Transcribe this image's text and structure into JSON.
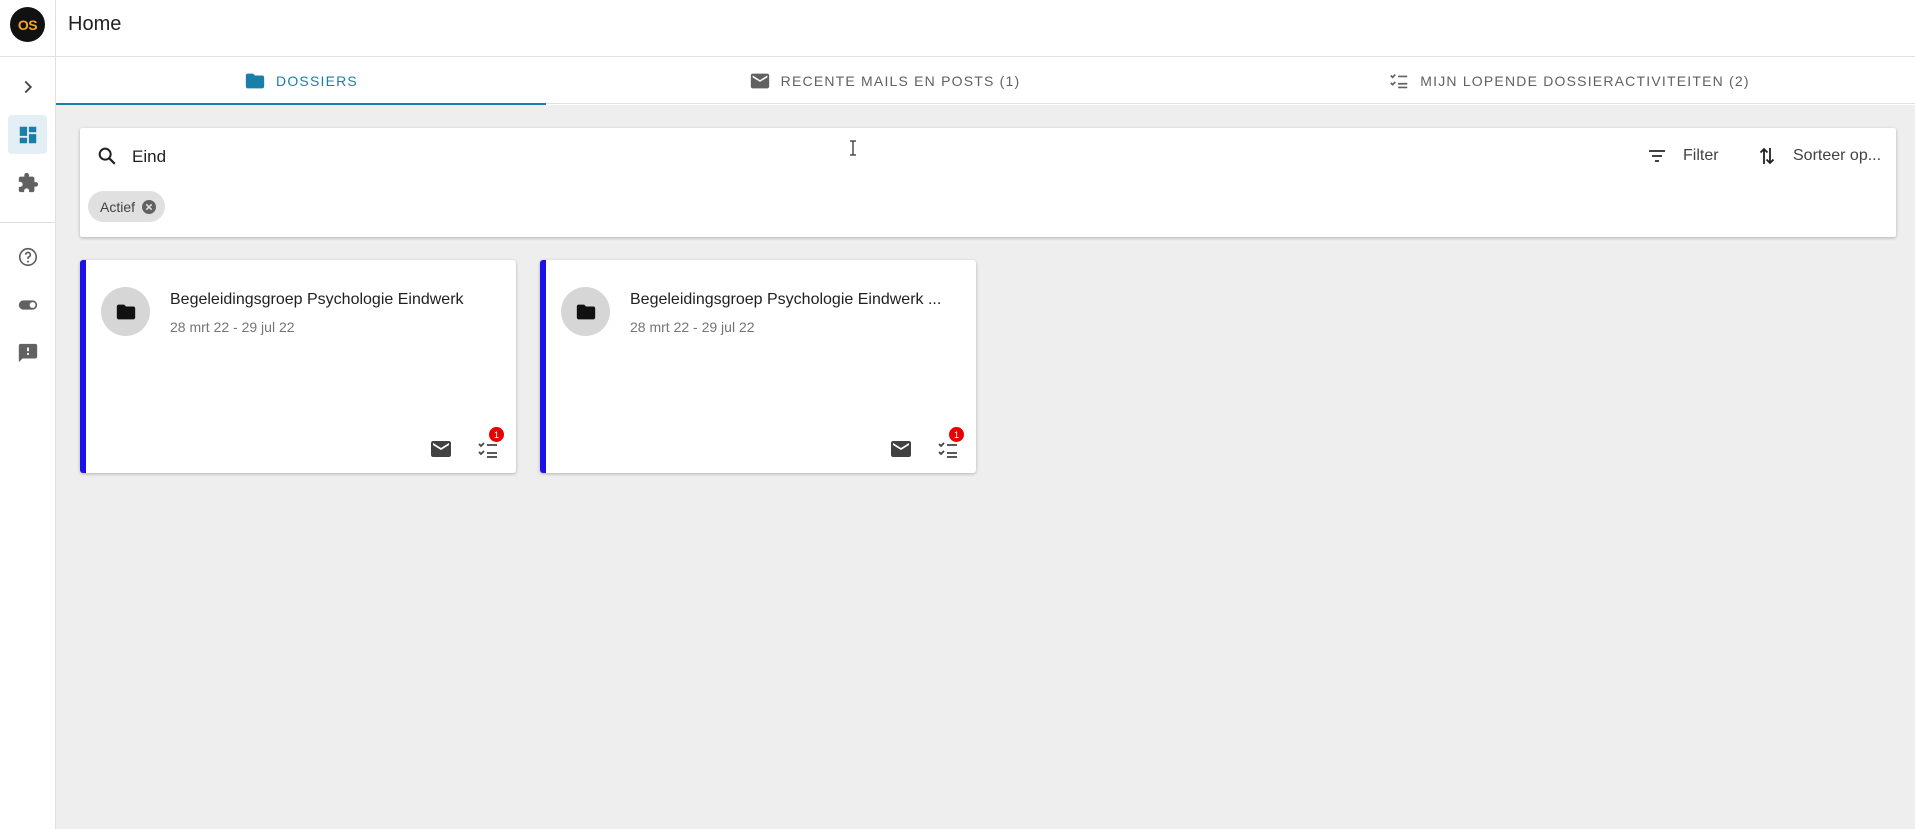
{
  "app": {
    "logo_text": "OS",
    "page_title": "Home"
  },
  "sidebar": {
    "items": [
      {
        "icon": "chevron-right-icon"
      },
      {
        "icon": "dashboard-icon",
        "active": true
      },
      {
        "icon": "puzzle-icon"
      },
      {
        "icon": "help-circle-icon"
      },
      {
        "icon": "toggle-icon"
      },
      {
        "icon": "feedback-icon"
      }
    ]
  },
  "tabs": [
    {
      "label": "DOSSIERS",
      "icon": "folder-icon",
      "active": true
    },
    {
      "label": "RECENTE MAILS EN POSTS (1)",
      "icon": "mail-icon",
      "active": false
    },
    {
      "label": "MIJN LOPENDE DOSSIERACTIVITEITEN (2)",
      "icon": "checklist-icon",
      "active": false
    }
  ],
  "search": {
    "value": "Eind",
    "placeholder": "",
    "filter_label": "Filter",
    "sort_label": "Sorteer op..."
  },
  "chips": [
    {
      "label": "Actief"
    }
  ],
  "cards": [
    {
      "title": "Begeleidingsgroep Psychologie Eindwerk",
      "dates": "28 mrt 22 - 29 jul 22",
      "task_badge": "1"
    },
    {
      "title": "Begeleidingsgroep Psychologie Eindwerk ...",
      "dates": "28 mrt 22 - 29 jul 22",
      "task_badge": "1"
    }
  ],
  "colors": {
    "accent": "#1a7fa8",
    "card_border": "#1a12e6",
    "badge": "#e60000",
    "logo_text": "#f5a623"
  }
}
